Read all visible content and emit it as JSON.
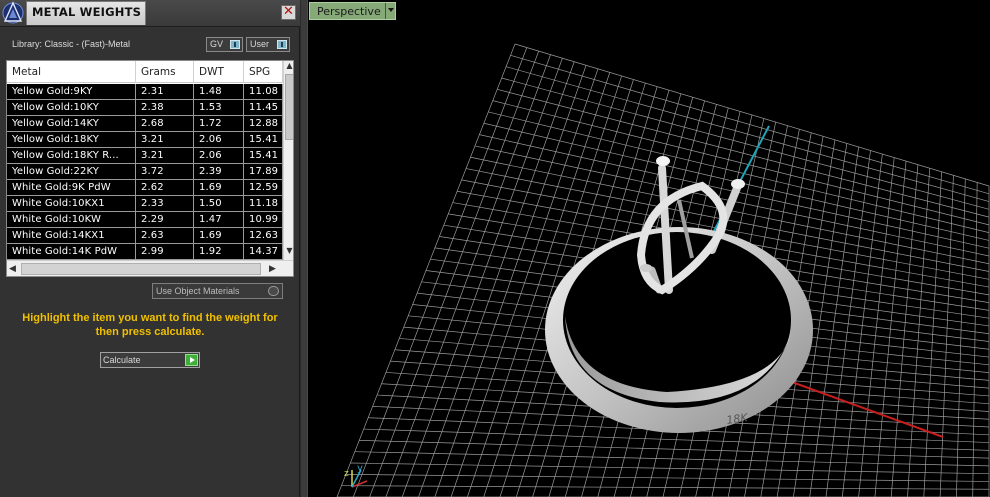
{
  "panel": {
    "title": "METAL WEIGHTS",
    "close_glyph": "✕",
    "library_label": "Library: Classic - (Fast)-Metal",
    "gv_label": "GV",
    "user_label": "User"
  },
  "table": {
    "columns": [
      "Metal",
      "Grams",
      "DWT",
      "SPG"
    ],
    "rows": [
      [
        "Yellow Gold:9KY",
        "2.31",
        "1.48",
        "11.08"
      ],
      [
        "Yellow Gold:10KY",
        "2.38",
        "1.53",
        "11.45"
      ],
      [
        "Yellow Gold:14KY",
        "2.68",
        "1.72",
        "12.88"
      ],
      [
        "Yellow Gold:18KY",
        "3.21",
        "2.06",
        "15.41"
      ],
      [
        "Yellow Gold:18KY R...",
        "3.21",
        "2.06",
        "15.41"
      ],
      [
        "Yellow Gold:22KY",
        "3.72",
        "2.39",
        "17.89"
      ],
      [
        "White Gold:9K PdW",
        "2.62",
        "1.69",
        "12.59"
      ],
      [
        "White Gold:10KX1",
        "2.33",
        "1.50",
        "11.18"
      ],
      [
        "White Gold:10KW",
        "2.29",
        "1.47",
        "10.99"
      ],
      [
        "White Gold:14KX1",
        "2.63",
        "1.69",
        "12.63"
      ],
      [
        "White Gold:14K PdW",
        "2.99",
        "1.92",
        "14.37"
      ]
    ],
    "scroll_up": "▲",
    "scroll_down": "▼",
    "scroll_left": "◀",
    "scroll_right": "▶"
  },
  "use_object_materials": "Use Object Materials",
  "instructions": "Highlight the item you want to find the weight for then press calculate.",
  "calculate_label": "Calculate",
  "viewport": {
    "view_mode": "Perspective",
    "ring_engraving": "18K",
    "axis_labels": {
      "z": "z",
      "y": "y"
    },
    "colors": {
      "grid": "#9a9a9a",
      "x_axis": "#c81e1e",
      "y_axis": "#1fa3b8",
      "ring": "#cfcfcf"
    }
  },
  "colors": {
    "instruction_text": "#f0c000",
    "view_tab": "#86a978",
    "calc_go": "#3fae3a"
  }
}
